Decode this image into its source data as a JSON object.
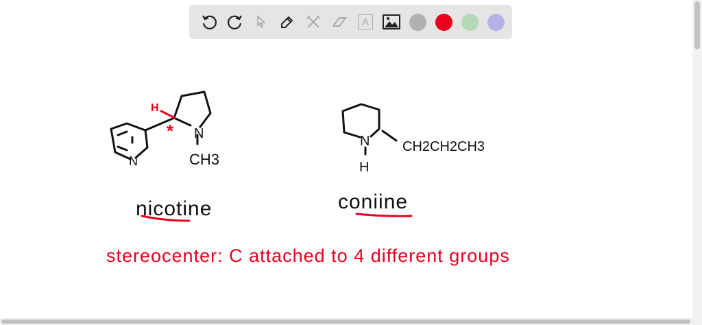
{
  "toolbar": {
    "tools": [
      "undo-icon",
      "redo-icon",
      "select-icon",
      "pen-icon",
      "tools-icon",
      "eraser-icon",
      "text-icon",
      "image-icon"
    ],
    "colors": [
      "#b0b0b0",
      "#e8001c",
      "#b5d9b5",
      "#b5b2ea"
    ],
    "text_tool_glyph": "A"
  },
  "board": {
    "nicotine": {
      "name": "nicotine",
      "ch3": "CH3",
      "n": "N",
      "h": "H",
      "star": "*"
    },
    "coniine": {
      "name": "coniine",
      "chain": "CH2CH2CH3",
      "n": "N",
      "h": "H"
    },
    "note": "stereocenter: C attached to 4 different groups"
  }
}
